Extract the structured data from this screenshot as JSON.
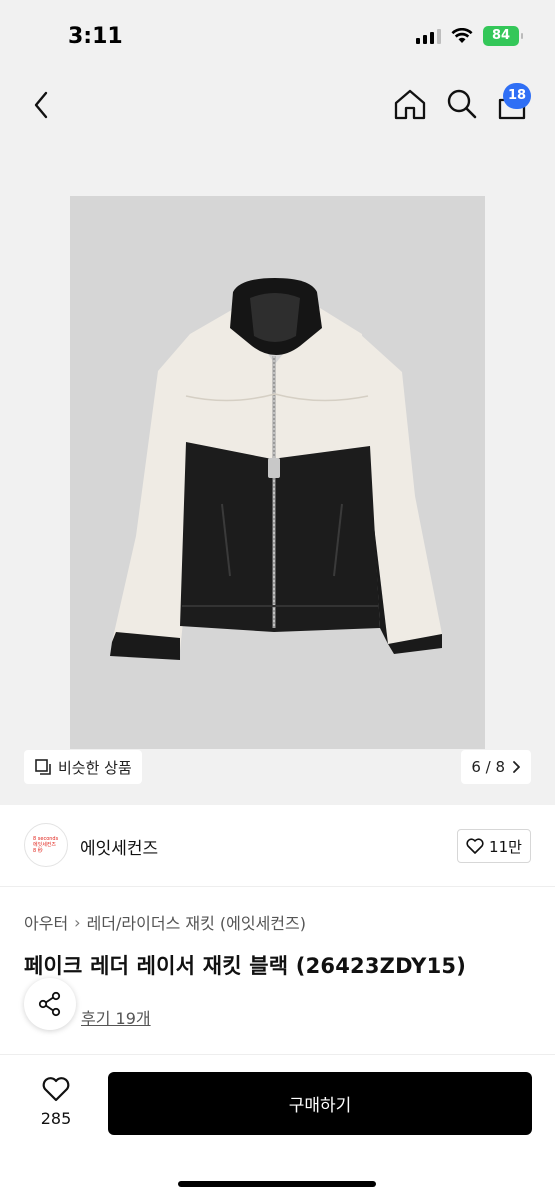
{
  "status_bar": {
    "time": "3:11",
    "battery": "84",
    "icons": [
      "signal-icon",
      "wifi-icon",
      "battery-icon"
    ]
  },
  "nav": {
    "icons": [
      "back-icon",
      "home-icon",
      "search-icon",
      "cart-icon"
    ],
    "cart_badge": "18"
  },
  "gallery": {
    "similar_label": "비슷한 상품",
    "page_indicator": "6 / 8",
    "icons": [
      "similar-icon",
      "chevron-right-icon"
    ],
    "image_background": "#d6d6d6"
  },
  "brand": {
    "logo_text": "8 seconds\n에잇세컨즈\n8 秒",
    "name": "에잇세컨즈",
    "favorite_count": "11만"
  },
  "product": {
    "breadcrumb": [
      "아우터",
      "레더/라이더스 재킷 (에잇세컨즈)"
    ],
    "title": "페이크 레더 레이서 재킷 블랙 (26423ZDY15)",
    "review_label": "후기 19개"
  },
  "bottom_bar": {
    "like_count": "285",
    "buy_label": "구매하기"
  },
  "colors": {
    "accent_badge": "#2f6ff5",
    "buy_button": "#000000",
    "brand_logo": "#e0241c",
    "battery": "#34c759"
  }
}
